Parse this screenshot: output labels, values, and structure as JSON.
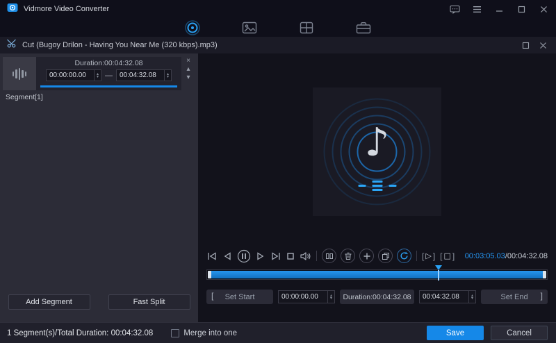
{
  "window": {
    "title": "Vidmore Video Converter"
  },
  "nav": {
    "tabs": [
      {
        "name": "converter",
        "active": true
      },
      {
        "name": "mv",
        "active": false
      },
      {
        "name": "collage",
        "active": false
      },
      {
        "name": "toolbox",
        "active": false
      }
    ]
  },
  "dialog": {
    "title": "Cut (Bugoy Drilon - Having You Near Me (320 kbps).mp3)"
  },
  "segment_panel": {
    "duration_label": "Duration:00:04:32.08",
    "start_value": "00:00:00.00",
    "range_separator": "—",
    "end_value": "00:04:32.08",
    "segment_label": "Segment[1]",
    "add_segment_label": "Add Segment",
    "fast_split_label": "Fast Split",
    "close_glyph": "×",
    "up_glyph": "▴",
    "down_glyph": "▾"
  },
  "player": {
    "current_time": "00:03:05.03",
    "time_separator": "/",
    "total_time": "00:04:32.08",
    "progress_percent": 68,
    "play_segment_glyph": "▷",
    "stop_segment_glyph": "□",
    "bracket_left": "[",
    "bracket_right": "]"
  },
  "trim": {
    "bracket_left": "[",
    "set_start_label": "Set Start",
    "start_value": "00:00:00.00",
    "duration_label": "Duration:00:04:32.08",
    "end_value": "00:04:32.08",
    "set_end_label": "Set End",
    "bracket_right": "]"
  },
  "footer": {
    "summary": "1 Segment(s)/Total Duration: 00:04:32.08",
    "merge_label": "Merge into one",
    "save_label": "Save",
    "cancel_label": "Cancel"
  },
  "colors": {
    "accent": "#1588e8",
    "accent_bright": "#2aa2f5"
  }
}
